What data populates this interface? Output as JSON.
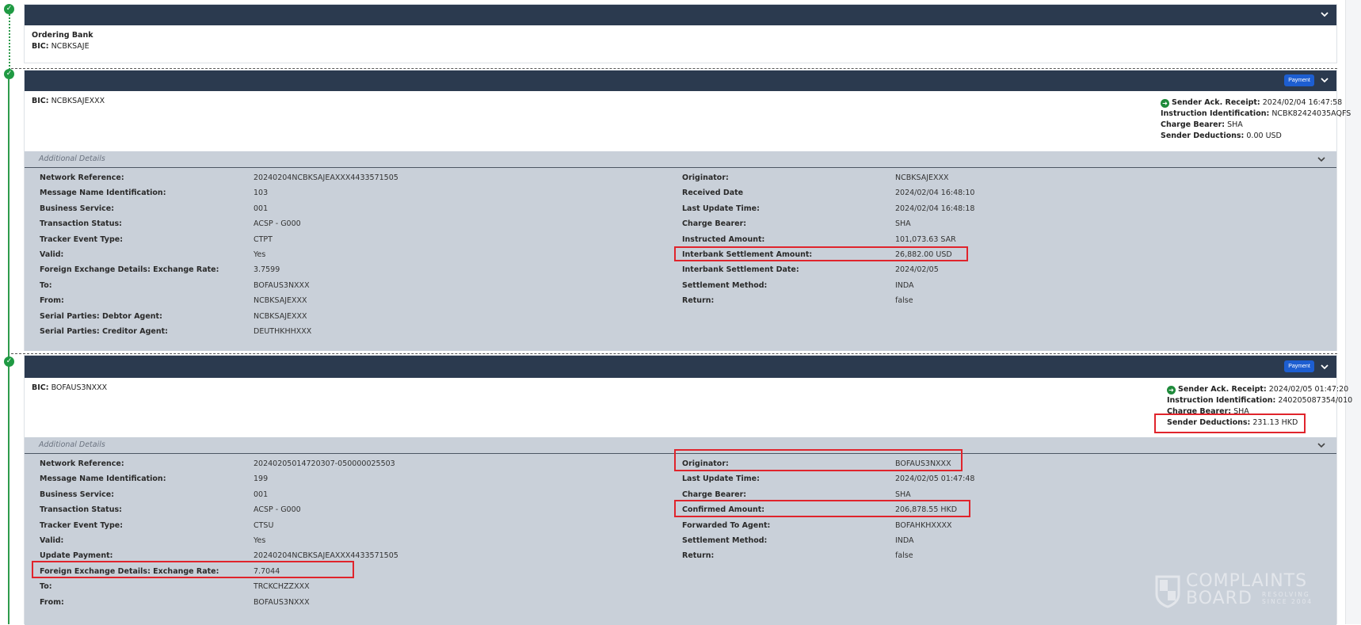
{
  "colors": {
    "header": "#2b3a4f",
    "accent": "#1d5ed1",
    "success": "#1f9a43",
    "highlight": "#e0242c"
  },
  "card1": {
    "title": "Ordering Bank",
    "bic_label": "BIC:",
    "bic": "NCBKSAJE"
  },
  "card2": {
    "bic_label": "BIC:",
    "bic": "NCBKSAJEXXX",
    "badge": "Payment",
    "info": {
      "ack_label": "Sender Ack. Receipt:",
      "ack": "2024/02/04 16:47:58",
      "instr_label": "Instruction Identification:",
      "instr": "NCBK82424035AQFS",
      "cb_label": "Charge Bearer:",
      "cb": "SHA",
      "ded_label": "Sender Deductions:",
      "ded": "0.00 USD"
    },
    "additional_title": "Additional Details",
    "left": [
      {
        "label": "Network Reference:",
        "value": "20240204NCBKSAJEAXXX4433571505"
      },
      {
        "label": "Message Name Identification:",
        "value": "103"
      },
      {
        "label": "Business Service:",
        "value": "001"
      },
      {
        "label": "Transaction Status:",
        "value": "ACSP -  G000"
      },
      {
        "label": "Tracker Event Type:",
        "value": "CTPT"
      },
      {
        "label": "Valid:",
        "value": "Yes"
      },
      {
        "label": "Foreign Exchange Details: Exchange Rate:",
        "value": "3.7599"
      },
      {
        "label": "To:",
        "value": "BOFAUS3NXXX"
      },
      {
        "label": "From:",
        "value": "NCBKSAJEXXX"
      },
      {
        "label": "Serial Parties: Debtor Agent:",
        "value": "NCBKSAJEXXX"
      },
      {
        "label": "Serial Parties: Creditor Agent:",
        "value": "DEUTHKHHXXX"
      }
    ],
    "right": [
      {
        "label": "Originator:",
        "value": "NCBKSAJEXXX"
      },
      {
        "label": "Received Date",
        "value": "2024/02/04 16:48:10"
      },
      {
        "label": "Last Update Time:",
        "value": "2024/02/04 16:48:18"
      },
      {
        "label": "Charge Bearer:",
        "value": "SHA"
      },
      {
        "label": "Instructed Amount:",
        "value": "101,073.63 SAR"
      },
      {
        "label": "Interbank Settlement Amount:",
        "value": "26,882.00 USD",
        "highlighted": true
      },
      {
        "label": "Interbank Settlement Date:",
        "value": "2024/02/05"
      },
      {
        "label": "Settlement Method:",
        "value": "INDA"
      },
      {
        "label": "Return:",
        "value": "false"
      }
    ]
  },
  "card3": {
    "bic_label": "BIC:",
    "bic": "BOFAUS3NXXX",
    "badge": "Payment",
    "info": {
      "ack_label": "Sender Ack. Receipt:",
      "ack": "2024/02/05 01:47:20",
      "instr_label": "Instruction Identification:",
      "instr": "240205087354/010",
      "cb_label": "Charge Bearer:",
      "cb": "SHA",
      "ded_label": "Sender Deductions:",
      "ded": "231.13 HKD"
    },
    "additional_title": "Additional Details",
    "left": [
      {
        "label": "Network Reference:",
        "value": "20240205014720307-050000025503"
      },
      {
        "label": "Message Name Identification:",
        "value": "199"
      },
      {
        "label": "Business Service:",
        "value": "001"
      },
      {
        "label": "Transaction Status:",
        "value": "ACSP -  G000"
      },
      {
        "label": "Tracker Event Type:",
        "value": "CTSU"
      },
      {
        "label": "Valid:",
        "value": "Yes"
      },
      {
        "label": "Update Payment:",
        "value": "20240204NCBKSAJEAXXX4433571505"
      },
      {
        "label": "Foreign Exchange Details: Exchange Rate:",
        "value": "7.7044",
        "highlighted": true
      },
      {
        "label": "To:",
        "value": "TRCKCHZZXXX"
      },
      {
        "label": "From:",
        "value": "BOFAUS3NXXX"
      }
    ],
    "right": [
      {
        "label": "Originator:",
        "value": "BOFAUS3NXXX",
        "highlighted": true
      },
      {
        "label": "Last Update Time:",
        "value": "2024/02/05 01:47:48"
      },
      {
        "label": "Charge Bearer:",
        "value": "SHA"
      },
      {
        "label": "Confirmed Amount:",
        "value": "206,878.55 HKD",
        "highlighted": true
      },
      {
        "label": "Forwarded To Agent:",
        "value": "BOFAHKHXXXX"
      },
      {
        "label": "Settlement Method:",
        "value": "INDA"
      },
      {
        "label": "Return:",
        "value": "false"
      }
    ]
  },
  "watermark": {
    "line1": "COMPLAINTS",
    "line2": "BOARD",
    "tag1": "RESOLVING",
    "tag2": "SINCE 2004"
  }
}
